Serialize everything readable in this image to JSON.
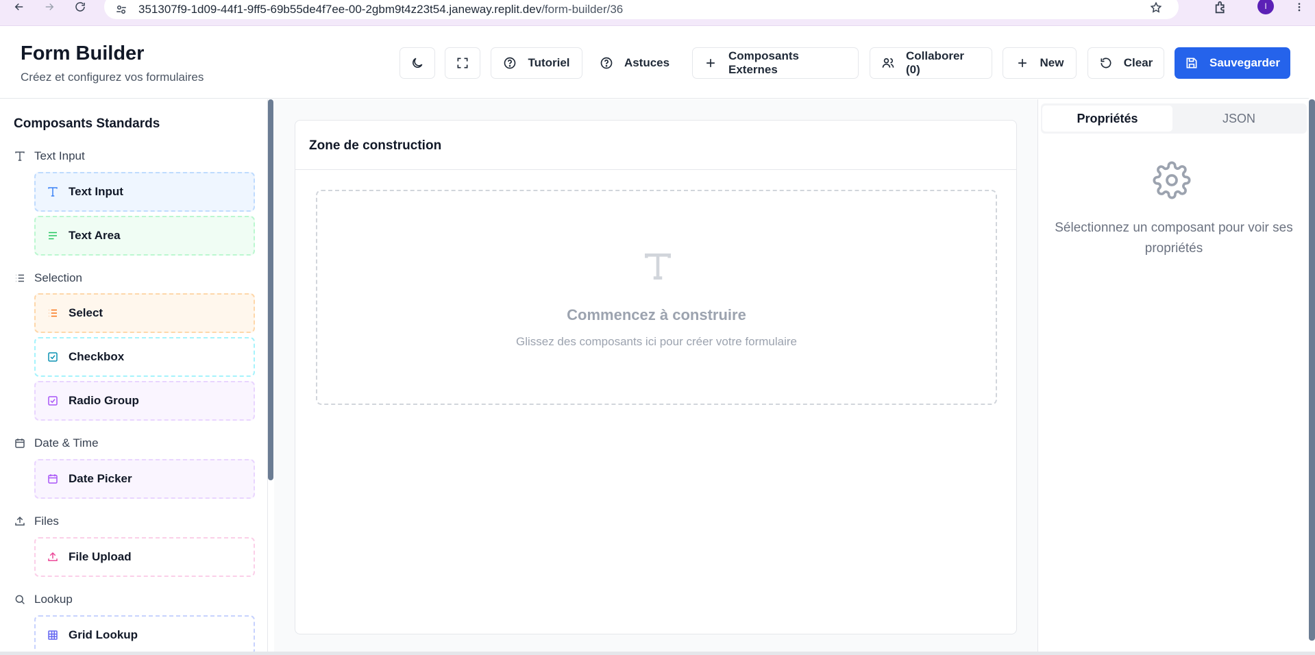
{
  "browser": {
    "url_host": "351307f9-1d09-44f1-9ff5-69b55de4f7ee-00-2gbm9t4z23t54.janeway.replit.dev",
    "url_path": "/form-builder/36",
    "avatar_initial": "I"
  },
  "header": {
    "title": "Form Builder",
    "subtitle": "Créez et configurez vos formulaires",
    "buttons": {
      "tutorial": "Tutoriel",
      "tips": "Astuces",
      "external": "Composants Externes",
      "collaborate": "Collaborer (0)",
      "new": "New",
      "clear": "Clear",
      "save": "Sauvegarder"
    }
  },
  "sidebar": {
    "title": "Composants Standards",
    "categories": [
      {
        "label": "Text Input",
        "items": [
          "Text Input",
          "Text Area"
        ]
      },
      {
        "label": "Selection",
        "items": [
          "Select",
          "Checkbox",
          "Radio Group"
        ]
      },
      {
        "label": "Date & Time",
        "items": [
          "Date Picker"
        ]
      },
      {
        "label": "Files",
        "items": [
          "File Upload"
        ]
      },
      {
        "label": "Lookup",
        "items": [
          "Grid Lookup"
        ]
      }
    ]
  },
  "canvas": {
    "title": "Zone de construction",
    "empty_title": "Commencez à construire",
    "empty_subtitle": "Glissez des composants ici pour créer votre formulaire"
  },
  "properties": {
    "tabs": [
      "Propriétés",
      "JSON"
    ],
    "empty_message": "Sélectionnez un composant pour voir ses propriétés"
  },
  "colors": {
    "primary": "#2563eb",
    "browser_bar": "#f3e9fa"
  }
}
